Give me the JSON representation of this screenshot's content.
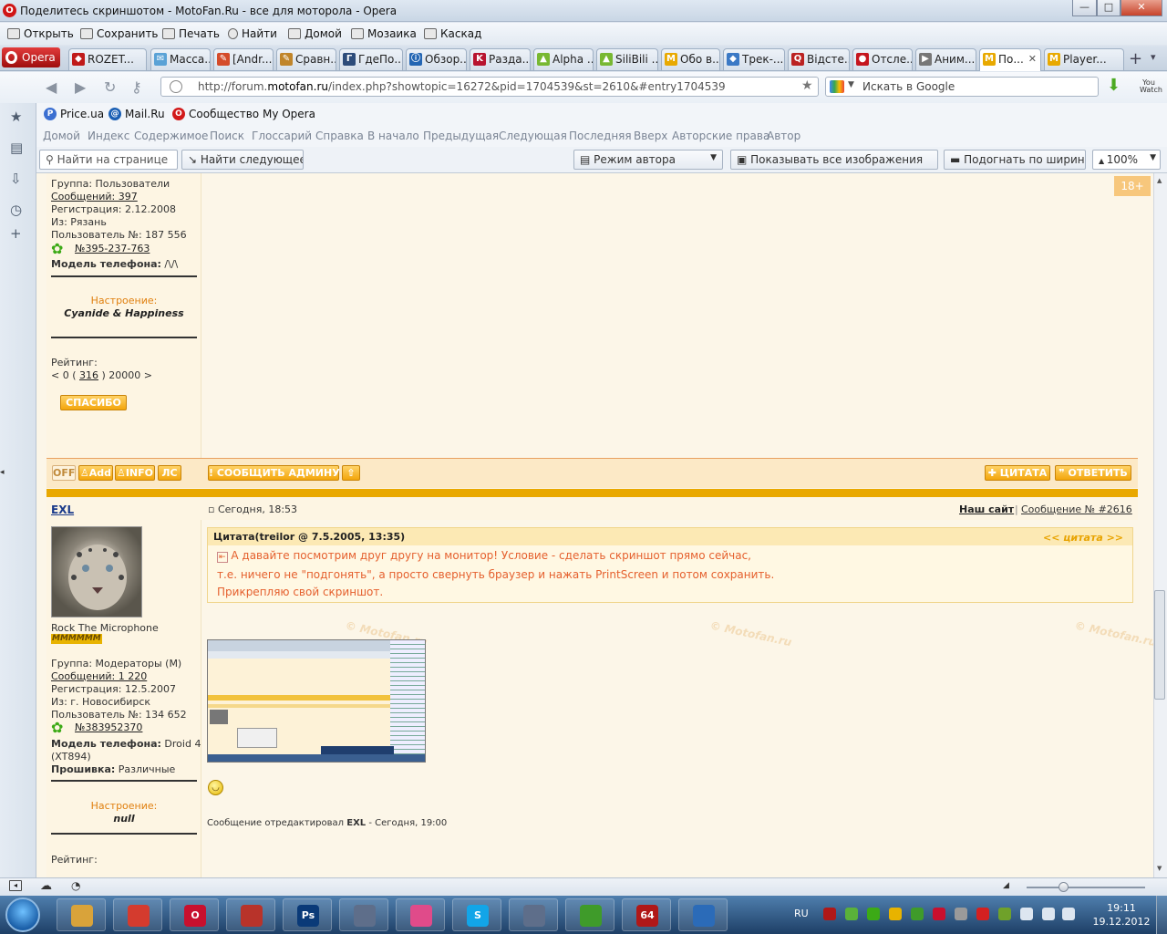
{
  "window": {
    "title": "Поделитесь скриншотом - MotoFan.Ru - все для моторола - Opera",
    "min": "—",
    "max": "□",
    "close": "✕"
  },
  "menu": [
    "Открыть",
    "Сохранить",
    "Печать",
    "Найти",
    "Домой",
    "Мозаика",
    "Каскад"
  ],
  "tabs": {
    "opera_label": "Opera",
    "items": [
      "ROZET...",
      "Масса...",
      "[Andr...",
      "Сравн...",
      "ГдеПо...",
      "Обзор...",
      "Разда...",
      "Alpha ...",
      "SiliBili ...",
      "Обо в...",
      "Трек-...",
      "Відсте...",
      "Отсле...",
      "Аним...",
      "По...",
      "Player..."
    ],
    "icons": [
      "◆",
      "✉",
      "✎",
      "✎",
      "Г",
      "ⓘ",
      "K",
      "▲",
      "▲",
      "M",
      "◆",
      "Q",
      "●",
      "▶",
      "M",
      "M"
    ],
    "icon_colors": [
      "#c01a1a",
      "#5aa2d6",
      "#d44b2a",
      "#c0852a",
      "#2d4c7a",
      "#2466b3",
      "#b8142f",
      "#78b832",
      "#78b832",
      "#e8a900",
      "#3b79c5",
      "#b22",
      "#c5161e",
      "#777",
      "#e8a900",
      "#e8a900"
    ],
    "active_index": 14,
    "close_mark": "✕",
    "plus": "+"
  },
  "address": {
    "url_prefix": "http://forum.",
    "url_host": "motofan.ru",
    "url_suffix": "/index.php?showtopic=16272&pid=1704539&st=2610&#entry1704539",
    "search_placeholder": "Искать в Google",
    "youwatch": "You Watch"
  },
  "bookmarks": [
    {
      "label": "Price.ua",
      "icon": "P",
      "color": "#3b6fd1"
    },
    {
      "label": "Mail.Ru",
      "icon": "@",
      "color": "#1a5fb4"
    },
    {
      "label": "Сообщество My Opera",
      "icon": "O",
      "color": "#d21919"
    }
  ],
  "navlinks": [
    "Домой",
    "Индекс",
    "Содержимое",
    "Поиск",
    "Глоссарий",
    "Справка",
    "В начало",
    "Предыдущая",
    "Следующая",
    "Последняя",
    "Вверх",
    "Авторские права",
    "Автор"
  ],
  "findbar": {
    "find_placeholder": "Найти на странице",
    "find_next": "Найти следующее",
    "mode": "Режим автора",
    "show_images": "Показывать все изображения",
    "fit_width": "Подогнать по ширине",
    "zoom": "100%"
  },
  "badge_18": "18+",
  "post1": {
    "group": "Группа: Пользователи",
    "messages": "Сообщений: 397",
    "reg": "Регистрация: 2.12.2008",
    "from": "Из: Рязань",
    "user_no": "Пользователь №: 187 556",
    "icq": "№395-237-763",
    "phone_label": "Модель телефона:",
    "phone_val": " /\\/\\",
    "mood_label": "Настроение:",
    "mood_val": "Cyanide & Happiness",
    "rating_label": "Рейтинг:",
    "rating_pre": "< 0 ( ",
    "rating_val": "316",
    "rating_post": " ) 20000 >",
    "thanks": "СПАСИБО"
  },
  "actions": {
    "off": "OFF",
    "add": "Add",
    "info": "INFO",
    "pm": "ЛС",
    "report": "СООБЩИТЬ АДМИНУ",
    "up": "⇧",
    "quote": "ЦИТАТА",
    "reply": "ОТВЕТИТЬ"
  },
  "post2": {
    "author": "EXL",
    "date": "Сегодня, 18:53",
    "our_site": "Наш сайт",
    "msg_no": "Сообщение № #2616",
    "title_line": "Rock The Microphone",
    "rank": "MMMMMM",
    "group": "Группа: Модераторы (M)",
    "messages": "Сообщений: 1 220",
    "reg": "Регистрация: 12.5.2007",
    "from": "Из: г. Новосибирск",
    "user_no": "Пользователь №: 134 652",
    "icq": "№383952370",
    "phone_label": "Модель телефона:",
    "phone_val": " Droid 4",
    "phone_val2": "(XT894)",
    "fw_label": "Прошивка:",
    "fw_val": " Различные",
    "mood_label": "Настроение:",
    "mood_val": "null",
    "rating_label": "Рейтинг:",
    "quote_head": "Цитата(treilor @ 7.5.2005, 13:35)",
    "quote_link": "<< цитата >>",
    "quote_lines": [
      "А давайте посмотрим друг другу на монитор! Условие - сделать скриншот прямо сейчас,",
      "т.е. ничего не \"подгонять\", а просто свернуть браузер и нажать PrintScreen и потом сохранить.",
      "Прикрепляю свой скриншот."
    ],
    "edited_pre": "Сообщение отредактировал ",
    "edited_by": "EXL",
    "edited_post": " - Сегодня, 19:00",
    "watermark": "© Motofan.ru"
  },
  "taskbar": {
    "apps": [
      {
        "label": "",
        "color": "#d9a33a"
      },
      {
        "label": "",
        "color": "#d43b2e"
      },
      {
        "label": "O",
        "color": "#c8102e"
      },
      {
        "label": "",
        "color": "#b8332a"
      },
      {
        "label": "Ps",
        "color": "#0a3a78"
      },
      {
        "label": "",
        "color": "#5e6e8a"
      },
      {
        "label": "",
        "color": "#e04b8a"
      },
      {
        "label": "S",
        "color": "#12a5e8"
      },
      {
        "label": "",
        "color": "#5e6e8a"
      },
      {
        "label": "",
        "color": "#3f9b2a"
      },
      {
        "label": "64",
        "color": "#b01818"
      },
      {
        "label": "",
        "color": "#2b6bb8"
      }
    ],
    "lang": "RU",
    "time": "19:11",
    "date": "19.12.2012"
  }
}
